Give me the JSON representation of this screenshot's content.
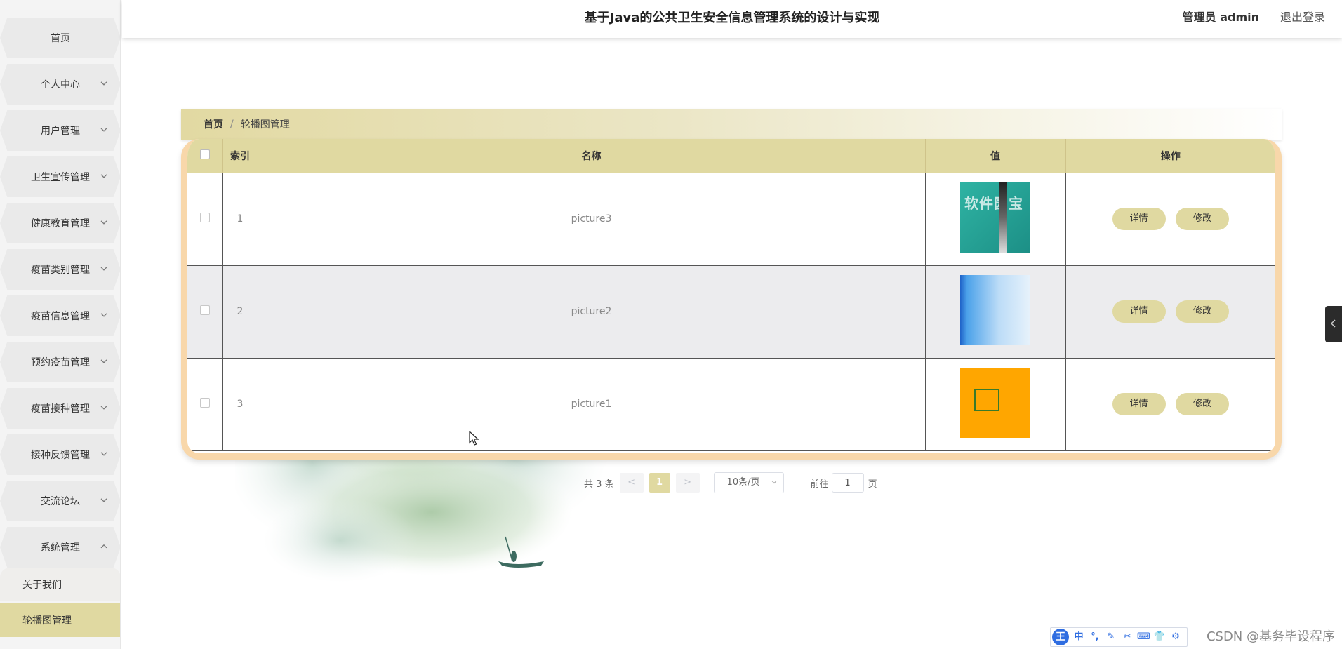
{
  "header": {
    "title": "基于Java的公共卫生安全信息管理系统的设计与实现",
    "user": "管理员 admin",
    "logout": "退出登录"
  },
  "sidebar": {
    "items": [
      {
        "label": "首页"
      },
      {
        "label": "个人中心"
      },
      {
        "label": "用户管理"
      },
      {
        "label": "卫生宣传管理"
      },
      {
        "label": "健康教育管理"
      },
      {
        "label": "疫苗类别管理"
      },
      {
        "label": "疫苗信息管理"
      },
      {
        "label": "预约疫苗管理"
      },
      {
        "label": "疫苗接种管理"
      },
      {
        "label": "接种反馈管理"
      },
      {
        "label": "交流论坛"
      },
      {
        "label": "系统管理"
      }
    ],
    "submenu": [
      {
        "label": "关于我们"
      },
      {
        "label": "轮播图管理"
      }
    ]
  },
  "breadcrumb": {
    "home": "首页",
    "separator": "/",
    "current": "轮播图管理"
  },
  "table": {
    "columns": [
      "索引",
      "名称",
      "值",
      "操作"
    ],
    "rows": [
      {
        "index": "1",
        "name": "picture3",
        "thumb_text": "软件园宝"
      },
      {
        "index": "2",
        "name": "picture2"
      },
      {
        "index": "3",
        "name": "picture1"
      }
    ],
    "actions": {
      "detail": "详情",
      "edit": "修改"
    }
  },
  "pagination": {
    "total": "共 3 条",
    "prev": "<",
    "next": ">",
    "current_page": "1",
    "page_size": "10条/页",
    "goto_label": "前往",
    "goto_value": "1",
    "page_unit": "页"
  },
  "ime": {
    "logo": "王",
    "mode": "中"
  },
  "watermark": "CSDN @基务毕设程序",
  "colors": {
    "accent": "#e0d9a1",
    "table_border": "#f8d7aa",
    "sidebar_bg": "#f4f4f4"
  }
}
